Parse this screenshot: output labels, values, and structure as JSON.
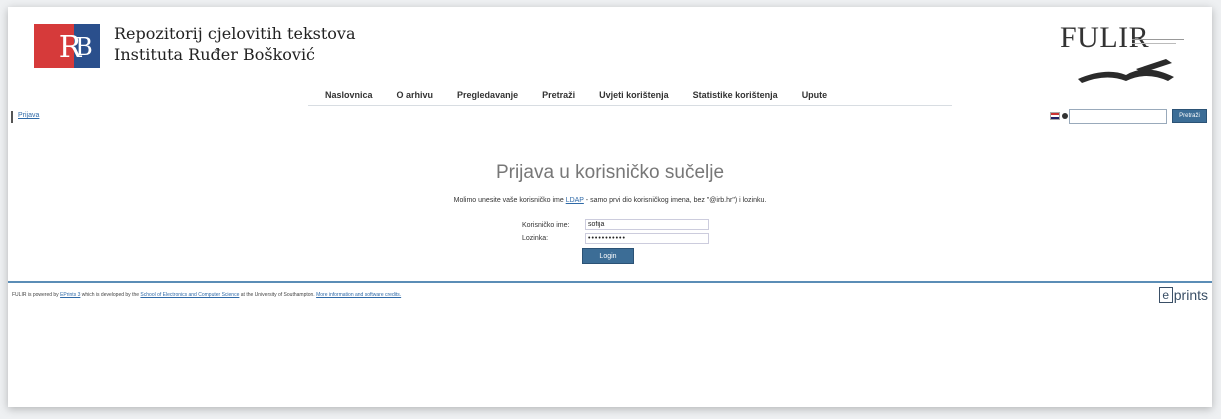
{
  "header": {
    "title_line1": "Repozitorij cjelovitih tekstova",
    "title_line2": "Instituta Ruđer Bošković",
    "fulir_logo_text": "FULIR"
  },
  "menu": [
    "Naslovnica",
    "O arhivu",
    "Pregledavanje",
    "Pretraži",
    "Uvjeti korištenja",
    "Statistike korištenja",
    "Upute"
  ],
  "breadcrumb": "Prijava",
  "search": {
    "button_label": "Pretraži",
    "value": ""
  },
  "main": {
    "title": "Prijava u korisničko sučelje",
    "instr_pre": "Molimo unesite vaše korisničko ime ",
    "instr_link": "LDAP",
    "instr_post": " - samo prvi dio korisničkog imena, bez \"@irb.hr\") i lozinku.",
    "username_label": "Korisničko ime:",
    "username_value": "sofija",
    "password_label": "Lozinka:",
    "password_value": "•••••••••••",
    "login_label": "Login"
  },
  "footer": {
    "t1": "FULIR is powered by ",
    "l1": "EPrints 3",
    "t2": " which is developed by the ",
    "l2": "School of Electronics and Computer Science",
    "t3": " at the University of Southampton. ",
    "l3": "More information and software credits.",
    "eprints_logo_text": "prints"
  },
  "colors": {
    "accent": "#3c6d96",
    "link": "#2f6aa8",
    "logo_red": "#d63a3a",
    "logo_blue": "#2a4f8c"
  }
}
